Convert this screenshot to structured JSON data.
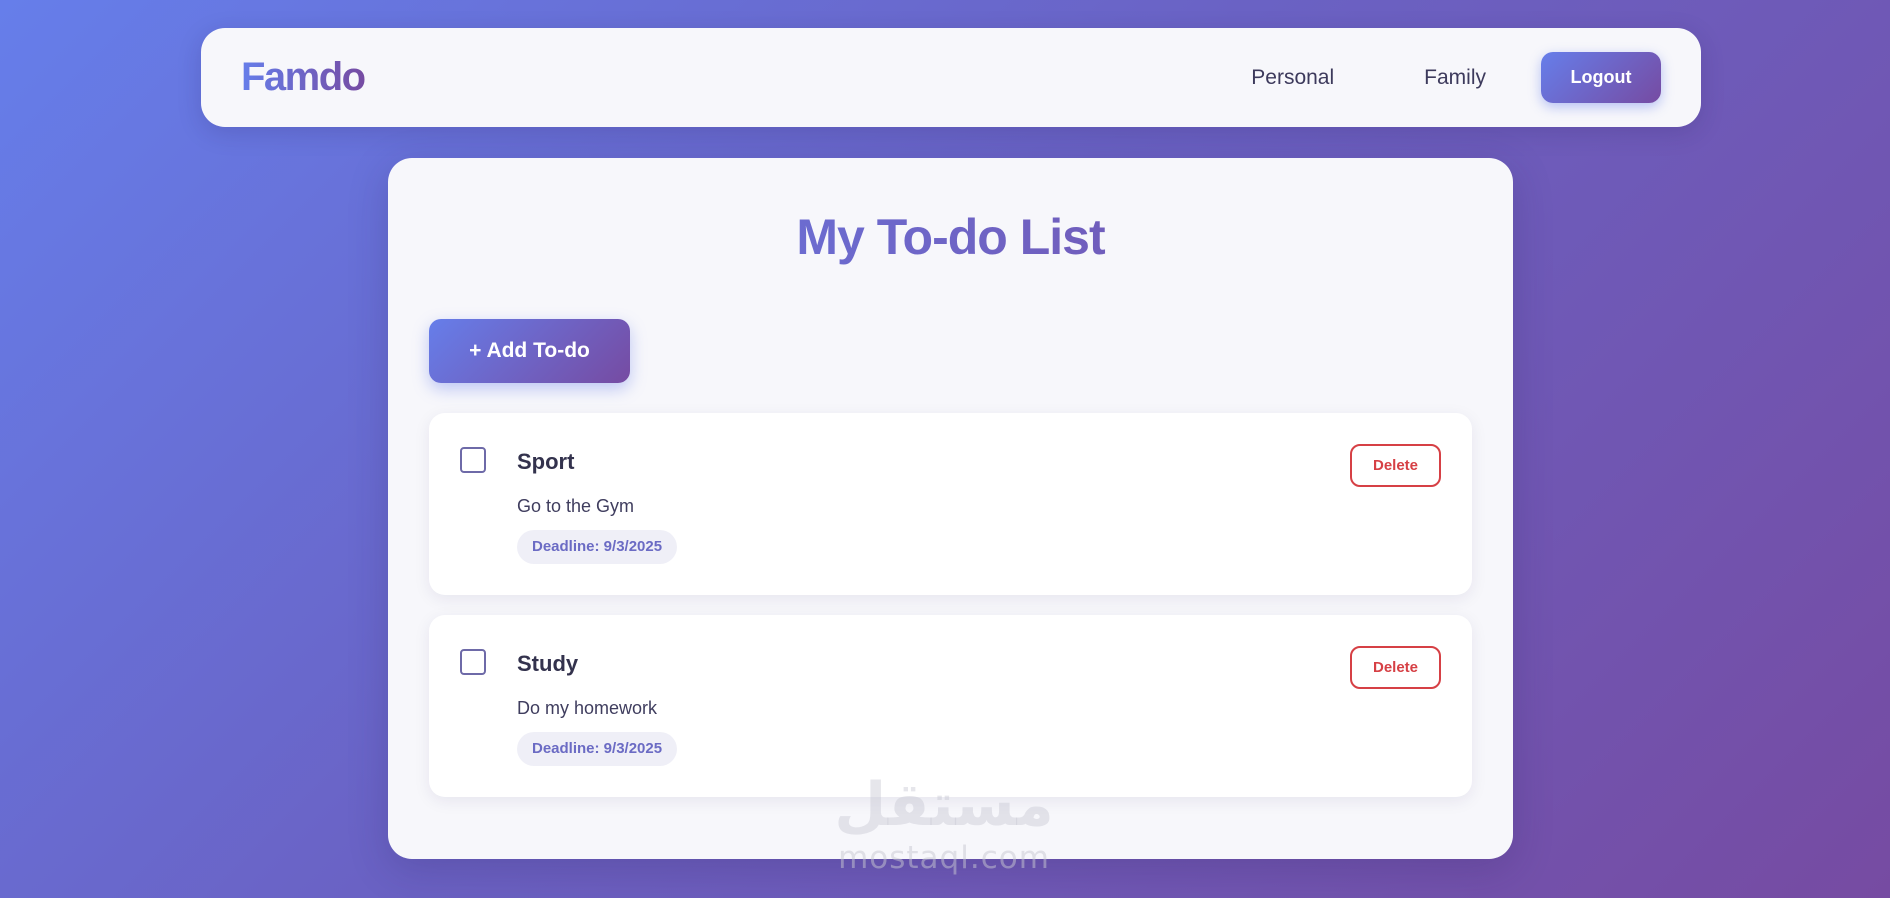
{
  "brand": "Famdo",
  "nav": {
    "links": [
      "Personal",
      "Family"
    ],
    "logout_label": "Logout"
  },
  "main": {
    "title": "My To-do List",
    "add_button_label": "+ Add To-do",
    "todos": [
      {
        "title": "Sport",
        "description": "Go to the Gym",
        "deadline": "Deadline: 9/3/2025",
        "delete_label": "Delete",
        "completed": false
      },
      {
        "title": "Study",
        "description": "Do my homework",
        "deadline": "Deadline: 9/3/2025",
        "delete_label": "Delete",
        "completed": false
      }
    ]
  },
  "watermark": {
    "arabic": "مستقل",
    "latin": "mostaql.com"
  },
  "colors": {
    "gradient_start": "#667eea",
    "gradient_end": "#764ba2",
    "delete": "#d64045",
    "card_bg": "#f7f7fb"
  }
}
